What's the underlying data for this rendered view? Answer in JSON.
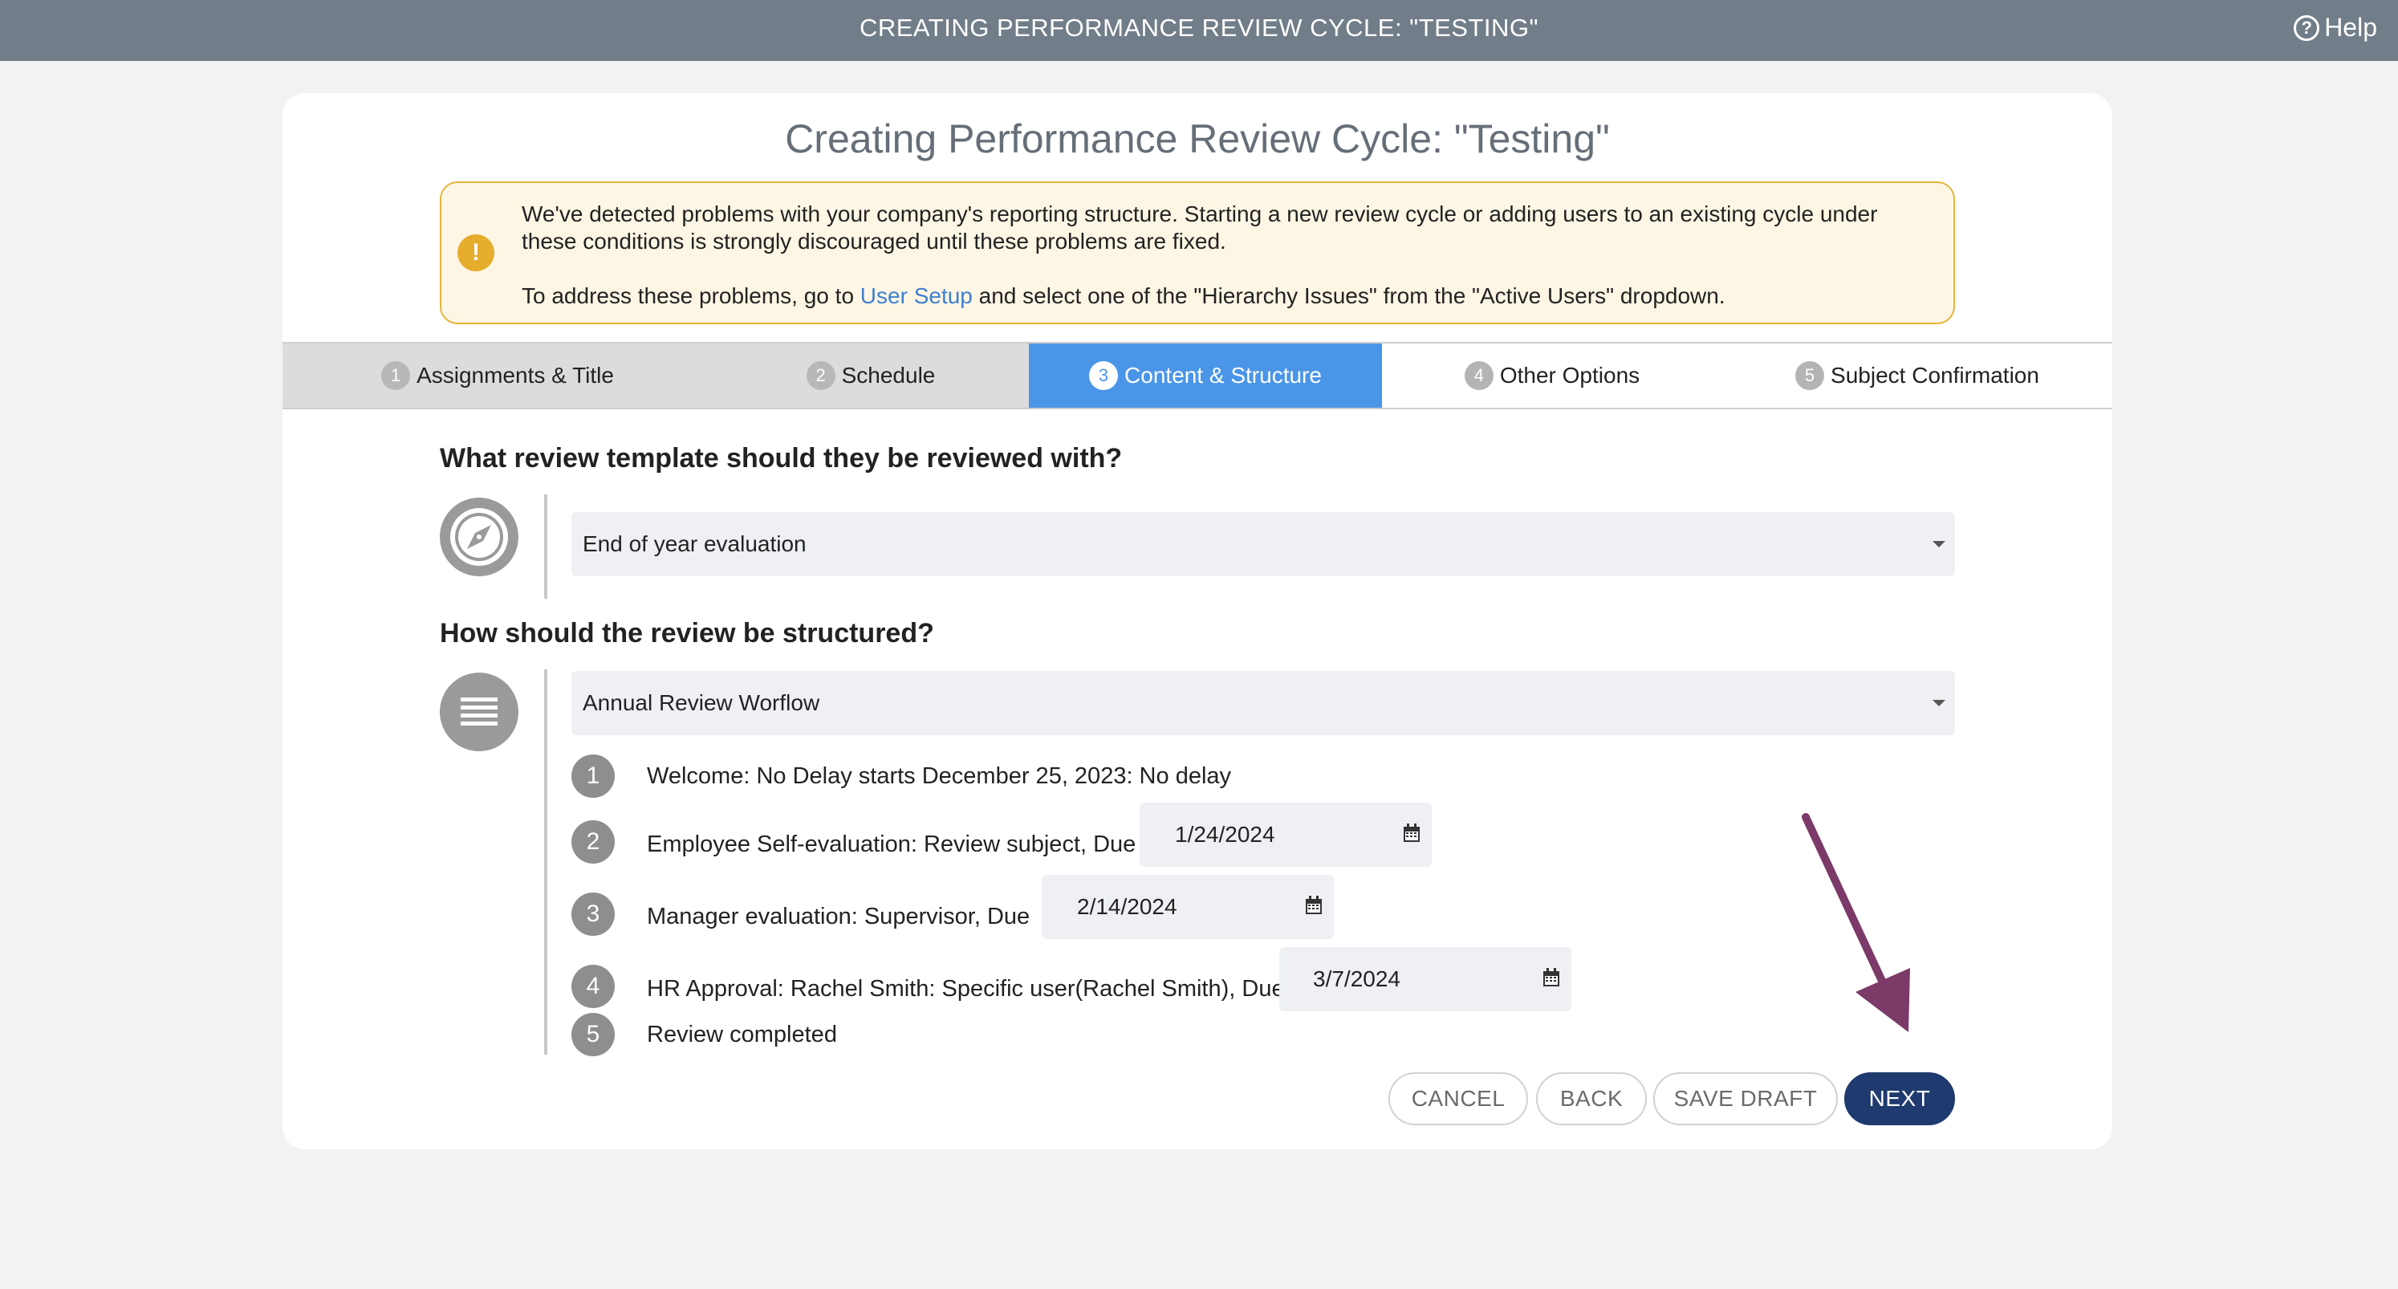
{
  "topbar": {
    "title": "CREATING PERFORMANCE REVIEW CYCLE: \"TESTING\"",
    "help_label": "Help"
  },
  "page": {
    "title": "Creating Performance Review Cycle: \"Testing\""
  },
  "alert": {
    "line1": "We've detected problems with your company's reporting structure. Starting a new review cycle or adding users to an existing cycle under these conditions is strongly discouraged until these problems are fixed.",
    "line2_prefix": "To address these problems, go to ",
    "line2_link": "User Setup",
    "line2_suffix": " and select one of the \"Hierarchy Issues\" from the \"Active Users\" dropdown.",
    "icon": "exclamation-icon"
  },
  "tabs": [
    {
      "num": "1",
      "label": "Assignments & Title",
      "state": "done"
    },
    {
      "num": "2",
      "label": "Schedule",
      "state": "done"
    },
    {
      "num": "3",
      "label": "Content & Structure",
      "state": "active"
    },
    {
      "num": "4",
      "label": "Other Options",
      "state": "pending"
    },
    {
      "num": "5",
      "label": "Subject Confirmation",
      "state": "pending"
    }
  ],
  "template_section": {
    "question": "What review template should they be reviewed with?",
    "selected": "End of year evaluation",
    "icon": "compass-icon"
  },
  "structure_section": {
    "question": "How should the review be structured?",
    "selected": "Annual Review Worflow",
    "icon": "list-icon"
  },
  "steps": [
    {
      "num": "1",
      "text": "Welcome: No Delay starts December 25, 2023: No delay"
    },
    {
      "num": "2",
      "text": "Employee Self-evaluation: Review subject, Due",
      "date": "1/24/2024"
    },
    {
      "num": "3",
      "text": "Manager evaluation: Supervisor, Due",
      "date": "2/14/2024"
    },
    {
      "num": "4",
      "text": "HR Approval: Rachel Smith: Specific user(Rachel Smith), Due",
      "date": "3/7/2024"
    },
    {
      "num": "5",
      "text": "Review completed"
    }
  ],
  "buttons": {
    "cancel": "CANCEL",
    "back": "BACK",
    "save_draft": "SAVE DRAFT",
    "next": "NEXT"
  },
  "colors": {
    "topbar": "#717d88",
    "active_tab": "#4a95e7",
    "primary_button": "#1f3a6e",
    "alert_border": "#e5b53c",
    "annotation_arrow": "#7b3a68"
  }
}
